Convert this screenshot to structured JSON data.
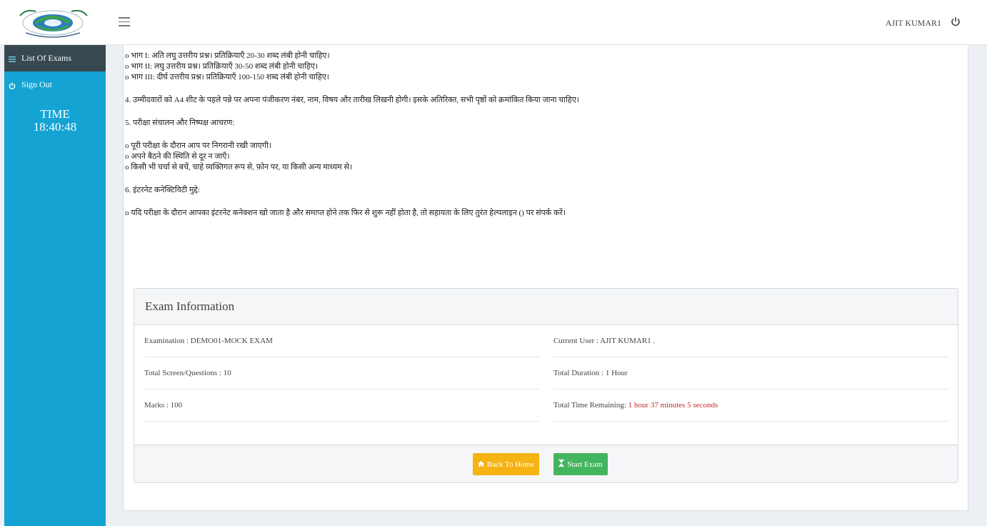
{
  "header": {
    "user_name": "AJIT KUMAR1"
  },
  "sidebar": {
    "items": [
      {
        "label": "List Of Exams",
        "icon": "list-icon"
      },
      {
        "label": "Sign Out",
        "icon": "power-icon"
      }
    ],
    "time_label": "TIME",
    "time_value": "18:40:48"
  },
  "instructions": {
    "lines": [
      "o भाग I: अति लघु उत्तरीय प्रश्न। प्रतिक्रियाएँ 20-30 शब्द लंबी होनी चाहिए।",
      "o भाग II: लघु उत्तरीय प्रश्न। प्रतिक्रियाएँ 30-50 शब्द लंबी होनी चाहिए।",
      "o भाग III: दीर्घ उत्तरीय प्रश्न। प्रतिक्रियाएँ 100-150 शब्द लंबी होनी चाहिए।",
      "4. उम्मीदवारों को A4 शीट के पहले पन्ने पर अपना पंजीकरण नंबर, नाम, विषय और तारीख लिखनी होगी। इसके अतिरिक्त, सभी पृष्ठों को क्रमांकित किया जाना चाहिए।",
      "5. परीक्षा संचालन और निष्पक्ष आचरण:",
      "o पूरी परीक्षा के दौरान आप पर निगरानी रखी जाएगी।",
      "o अपने बैठने की स्थिति से दूर न जाएँ।",
      "o किसी भी चर्चा से बचें, चाहे व्यक्तिगत रूप से, फ़ोन पर, या किसी अन्य माध्यम से।",
      "6. इंटरनेट कनेक्टिविटी मुद्दे:",
      "o यदि परीक्षा के दौरान आपका इंटरनेट कनेक्शन खो जाता है और समाप्त होने तक फिर से शुरू नहीं होता है, तो सहायता के लिए तुरंत हेल्पलाइन () पर संपर्क करें।"
    ]
  },
  "exam_info": {
    "title": "Exam Information",
    "examination": "Examination : DEMO01-MOCK EXAM",
    "current_user": "Current User : AJIT KUMAR1 .",
    "total_questions": "Total Screen/Questions : 10",
    "total_duration": "Total Duration : 1 Hour",
    "marks": "Marks : 100",
    "time_remaining_label": "Total Time Remaining: ",
    "time_remaining_value": "1 hour 37 minutes 5 seconds",
    "back_button": "Back To Home",
    "start_button": "Start Exam"
  },
  "colors": {
    "sidebar": "#15a3d4",
    "sidebar_active": "#374850",
    "back_button": "#f5b314",
    "start_button": "#44b55f",
    "remaining_time": "#c12b2b"
  }
}
